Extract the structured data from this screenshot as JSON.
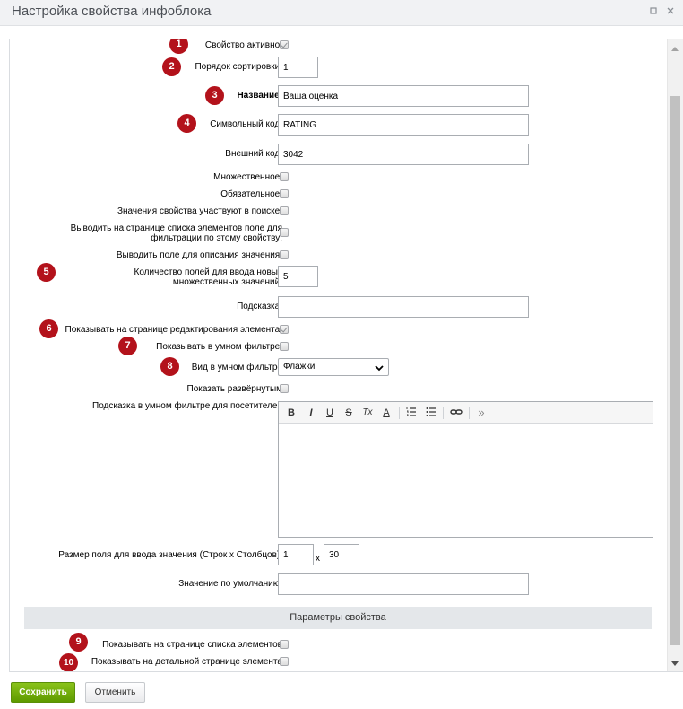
{
  "window": {
    "title": "Настройка свойства инфоблока",
    "icons": [
      "restore-icon",
      "close-icon"
    ]
  },
  "form": {
    "active_label": "Свойство активно:",
    "sort_label": "Порядок сортировки:",
    "sort_value": "1",
    "name_label": "Название:",
    "name_value": "Ваша оценка",
    "code_label": "Символьный код:",
    "code_value": "RATING",
    "xml_id_label": "Внешний код:",
    "xml_id_value": "3042",
    "multiple_label": "Множественное:",
    "required_label": "Обязательное:",
    "searchable_label": "Значения свойства участвуют в поиске:",
    "filtrable_label": "Выводить на странице списка элементов поле для фильтрации по этому свойству:",
    "with_description_label": "Выводить поле для описания значения:",
    "multiple_cnt_label": "Количество полей для ввода новых множественных значений:",
    "multiple_cnt_value": "5",
    "hint_label": "Подсказка:",
    "hint_value": "",
    "show_edit_label": "Показывать на странице редактирования элемента:",
    "smart_filter_label": "Показывать в умном фильтре:",
    "smart_view_label": "Вид в умном фильтре",
    "smart_view_value": "Флажки",
    "expanded_label": "Показать развёрнутым",
    "smart_hint_label": "Подсказка в умном фильтре для посетителей",
    "size_label": "Размер поля для ввода значения (Строк x Столбцов):",
    "rows_value": "1",
    "cols_value": "30",
    "size_separator": "x",
    "default_label": "Значение по умолчанию:",
    "default_value": ""
  },
  "checkboxes": {
    "active": true,
    "multiple": false,
    "required": false,
    "searchable": false,
    "filtrable": false,
    "with_description": false,
    "show_edit": true,
    "smart_filter": false,
    "expanded": false,
    "list_page": false,
    "detail_page": false
  },
  "editor_toolbar": {
    "bold": "B",
    "italic": "I",
    "underline": "U",
    "strike": "S",
    "clear_format": "Tx",
    "font_color": "A",
    "more": "»",
    "icons": [
      "bold-icon",
      "italic-icon",
      "underline-icon",
      "strikethrough-icon",
      "remove-format-icon",
      "font-color-icon",
      "ordered-list-icon",
      "unordered-list-icon",
      "link-icon",
      "more-icon"
    ]
  },
  "section": {
    "title": "Параметры свойства",
    "list_page_label": "Показывать на странице списка элементов",
    "detail_page_label": "Показывать на детальной странице элемента"
  },
  "badges": [
    "1",
    "2",
    "3",
    "4",
    "5",
    "6",
    "7",
    "8",
    "9",
    "10"
  ],
  "buttons": {
    "save": "Сохранить",
    "cancel": "Отменить"
  },
  "colors": {
    "badge": "#b3121b",
    "save_button": "#6fae0c",
    "section_bg": "#e4e7ea"
  }
}
